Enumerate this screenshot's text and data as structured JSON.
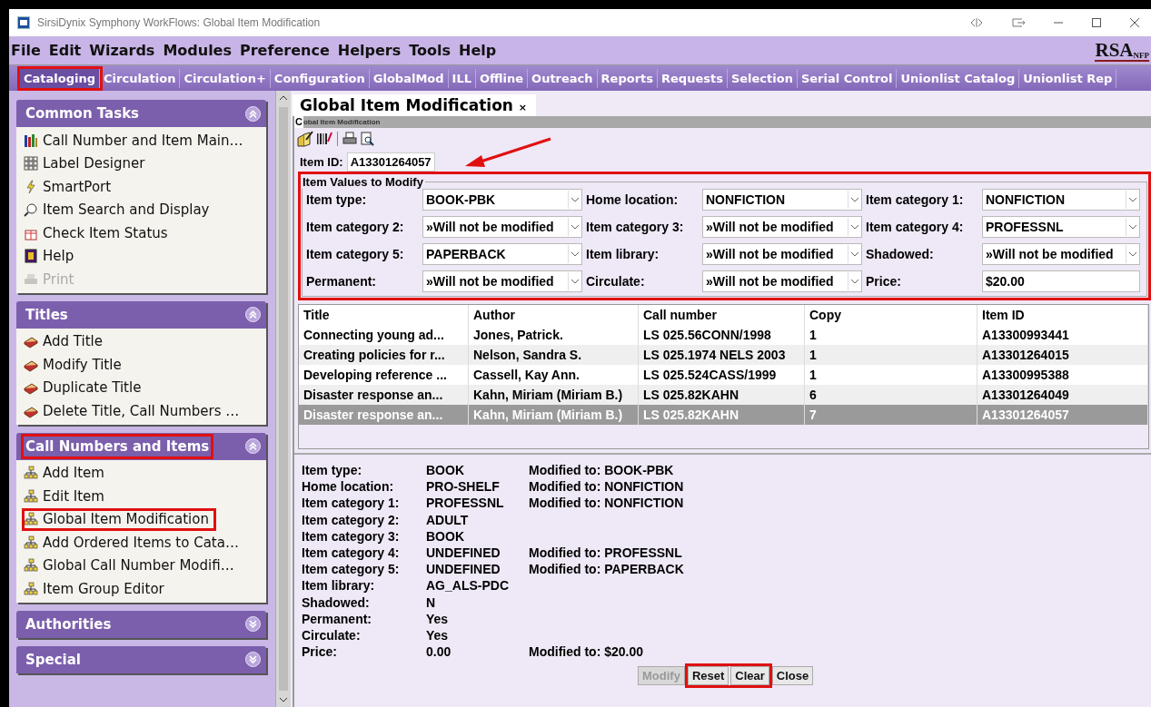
{
  "window": {
    "title": "SirsiDynix Symphony WorkFlows: Global Item Modification"
  },
  "menu": [
    "File",
    "Edit",
    "Wizards",
    "Modules",
    "Preference",
    "Helpers",
    "Tools",
    "Help"
  ],
  "logo": {
    "text": "RSA",
    "subtext": "NFP"
  },
  "modules": [
    {
      "label": "Cataloging",
      "selected": true,
      "highlighted": true
    },
    {
      "label": "Circulation",
      "selected": false,
      "highlighted": false
    },
    {
      "label": "Circulation+",
      "selected": false,
      "highlighted": false
    },
    {
      "label": "Configuration",
      "selected": false,
      "highlighted": false
    },
    {
      "label": "GlobalMod",
      "selected": false,
      "highlighted": false
    },
    {
      "label": "ILL",
      "selected": false,
      "highlighted": false
    },
    {
      "label": "Offline",
      "selected": false,
      "highlighted": false
    },
    {
      "label": "Outreach",
      "selected": false,
      "highlighted": false
    },
    {
      "label": "Reports",
      "selected": false,
      "highlighted": false
    },
    {
      "label": "Requests",
      "selected": false,
      "highlighted": false
    },
    {
      "label": "Selection",
      "selected": false,
      "highlighted": false
    },
    {
      "label": "Serial Control",
      "selected": false,
      "highlighted": false
    },
    {
      "label": "Unionlist Catalog",
      "selected": false,
      "highlighted": false
    },
    {
      "label": "Unionlist Rep",
      "selected": false,
      "highlighted": false
    }
  ],
  "sidebar": [
    {
      "title": "Common Tasks",
      "expanded": true,
      "highlighted": false,
      "items": [
        {
          "label": "Call Number and Item Main…",
          "disabled": false,
          "highlighted": false
        },
        {
          "label": "Label Designer",
          "disabled": false,
          "highlighted": false
        },
        {
          "label": "SmartPort",
          "disabled": false,
          "highlighted": false
        },
        {
          "label": "Item Search and Display",
          "disabled": false,
          "highlighted": false
        },
        {
          "label": "Check Item Status",
          "disabled": false,
          "highlighted": false
        },
        {
          "label": "Help",
          "disabled": false,
          "highlighted": false
        },
        {
          "label": "Print",
          "disabled": true,
          "highlighted": false
        }
      ]
    },
    {
      "title": "Titles",
      "expanded": true,
      "highlighted": false,
      "items": [
        {
          "label": "Add Title",
          "disabled": false,
          "highlighted": false
        },
        {
          "label": "Modify Title",
          "disabled": false,
          "highlighted": false
        },
        {
          "label": "Duplicate Title",
          "disabled": false,
          "highlighted": false
        },
        {
          "label": "Delete Title, Call Numbers …",
          "disabled": false,
          "highlighted": false
        }
      ]
    },
    {
      "title": "Call Numbers and Items",
      "expanded": true,
      "highlighted": true,
      "items": [
        {
          "label": "Add Item",
          "disabled": false,
          "highlighted": false
        },
        {
          "label": "Edit Item",
          "disabled": false,
          "highlighted": false
        },
        {
          "label": "Global Item Modification",
          "disabled": false,
          "highlighted": true
        },
        {
          "label": "Add Ordered Items to Cata…",
          "disabled": false,
          "highlighted": false
        },
        {
          "label": "Global Call Number Modifi…",
          "disabled": false,
          "highlighted": false
        },
        {
          "label": "Item Group Editor",
          "disabled": false,
          "highlighted": false
        }
      ]
    },
    {
      "title": "Authorities",
      "expanded": false,
      "highlighted": false
    },
    {
      "title": "Special",
      "expanded": false,
      "highlighted": false
    }
  ],
  "document_tab": {
    "label": "Global Item Modification",
    "close": "×"
  },
  "panel_strip": {
    "mark": "C",
    "title": "obal Item Modification"
  },
  "item_id": {
    "label": "Item ID:",
    "value": "A13301264057"
  },
  "values_group": {
    "title": "Item Values to Modify",
    "highlighted": true,
    "fields": [
      {
        "label": "Item type:",
        "value": "BOOK-PBK",
        "kind": "select"
      },
      {
        "label": "Home location:",
        "value": "NONFICTION",
        "kind": "select"
      },
      {
        "label": "Item category 1:",
        "value": "NONFICTION",
        "kind": "select"
      },
      {
        "label": "Item category 2:",
        "value": "»Will not be modified",
        "kind": "select"
      },
      {
        "label": "Item category 3:",
        "value": "»Will not be modified",
        "kind": "select"
      },
      {
        "label": "Item category 4:",
        "value": "PROFESSNL",
        "kind": "select"
      },
      {
        "label": "Item category 5:",
        "value": "PAPERBACK",
        "kind": "select"
      },
      {
        "label": "Item library:",
        "value": "»Will not be modified",
        "kind": "select"
      },
      {
        "label": "Shadowed:",
        "value": "»Will not be modified",
        "kind": "select"
      },
      {
        "label": "Permanent:",
        "value": "»Will not be modified",
        "kind": "select"
      },
      {
        "label": "Circulate:",
        "value": "»Will not be modified",
        "kind": "select"
      },
      {
        "label": "Price:",
        "value": "$20.00",
        "kind": "text"
      }
    ]
  },
  "table": {
    "columns": [
      "Title",
      "Author",
      "Call number",
      "Copy",
      "Item ID"
    ],
    "rows": [
      {
        "cells": [
          "Connecting young ad...",
          "Jones, Patrick.",
          "LS 025.56CONN/1998",
          "1",
          "A13300993441"
        ],
        "selected": false
      },
      {
        "cells": [
          "Creating policies for r...",
          "Nelson, Sandra S.",
          "LS 025.1974 NELS 2003",
          "1",
          "A13301264015"
        ],
        "selected": false
      },
      {
        "cells": [
          "Developing reference ...",
          "Cassell, Kay Ann.",
          "LS 025.524CASS/1999",
          "1",
          "A13300995388"
        ],
        "selected": false
      },
      {
        "cells": [
          "Disaster response an...",
          "Kahn, Miriam (Miriam B.)",
          "LS 025.82KAHN",
          "6",
          "A13301264049"
        ],
        "selected": false
      },
      {
        "cells": [
          "Disaster response an...",
          "Kahn, Miriam (Miriam B.)",
          "LS 025.82KAHN",
          "7",
          "A13301264057"
        ],
        "selected": true
      }
    ]
  },
  "details": [
    {
      "label": "Item type:",
      "value": "BOOK",
      "modified_label": "Modified to:",
      "modified": "BOOK-PBK"
    },
    {
      "label": "Home location:",
      "value": "PRO-SHELF",
      "modified_label": "Modified to:",
      "modified": "NONFICTION"
    },
    {
      "label": "Item category 1:",
      "value": "PROFESSNL",
      "modified_label": "Modified to:",
      "modified": "NONFICTION"
    },
    {
      "label": "Item category 2:",
      "value": "ADULT"
    },
    {
      "label": "Item category 3:",
      "value": "BOOK"
    },
    {
      "label": "Item category 4:",
      "value": "UNDEFINED",
      "modified_label": "Modified to:",
      "modified": "PROFESSNL"
    },
    {
      "label": "Item category 5:",
      "value": "UNDEFINED",
      "modified_label": "Modified to:",
      "modified": "PAPERBACK"
    },
    {
      "label": "Item library:",
      "value": "AG_ALS-PDC"
    },
    {
      "label": "Shadowed:",
      "value": "N"
    },
    {
      "label": "Permanent:",
      "value": "Yes"
    },
    {
      "label": "Circulate:",
      "value": "Yes"
    },
    {
      "label": "Price:",
      "value": "0.00",
      "modified_label": "Modified to:",
      "modified": "$20.00"
    }
  ],
  "buttons": [
    {
      "label": "Modify",
      "disabled": true,
      "highlighted": false
    },
    {
      "label": "Reset",
      "disabled": false,
      "highlighted": true
    },
    {
      "label": "Clear",
      "disabled": false,
      "highlighted": true
    },
    {
      "label": "Close",
      "disabled": false,
      "highlighted": false
    }
  ],
  "annotation_arrow": true
}
